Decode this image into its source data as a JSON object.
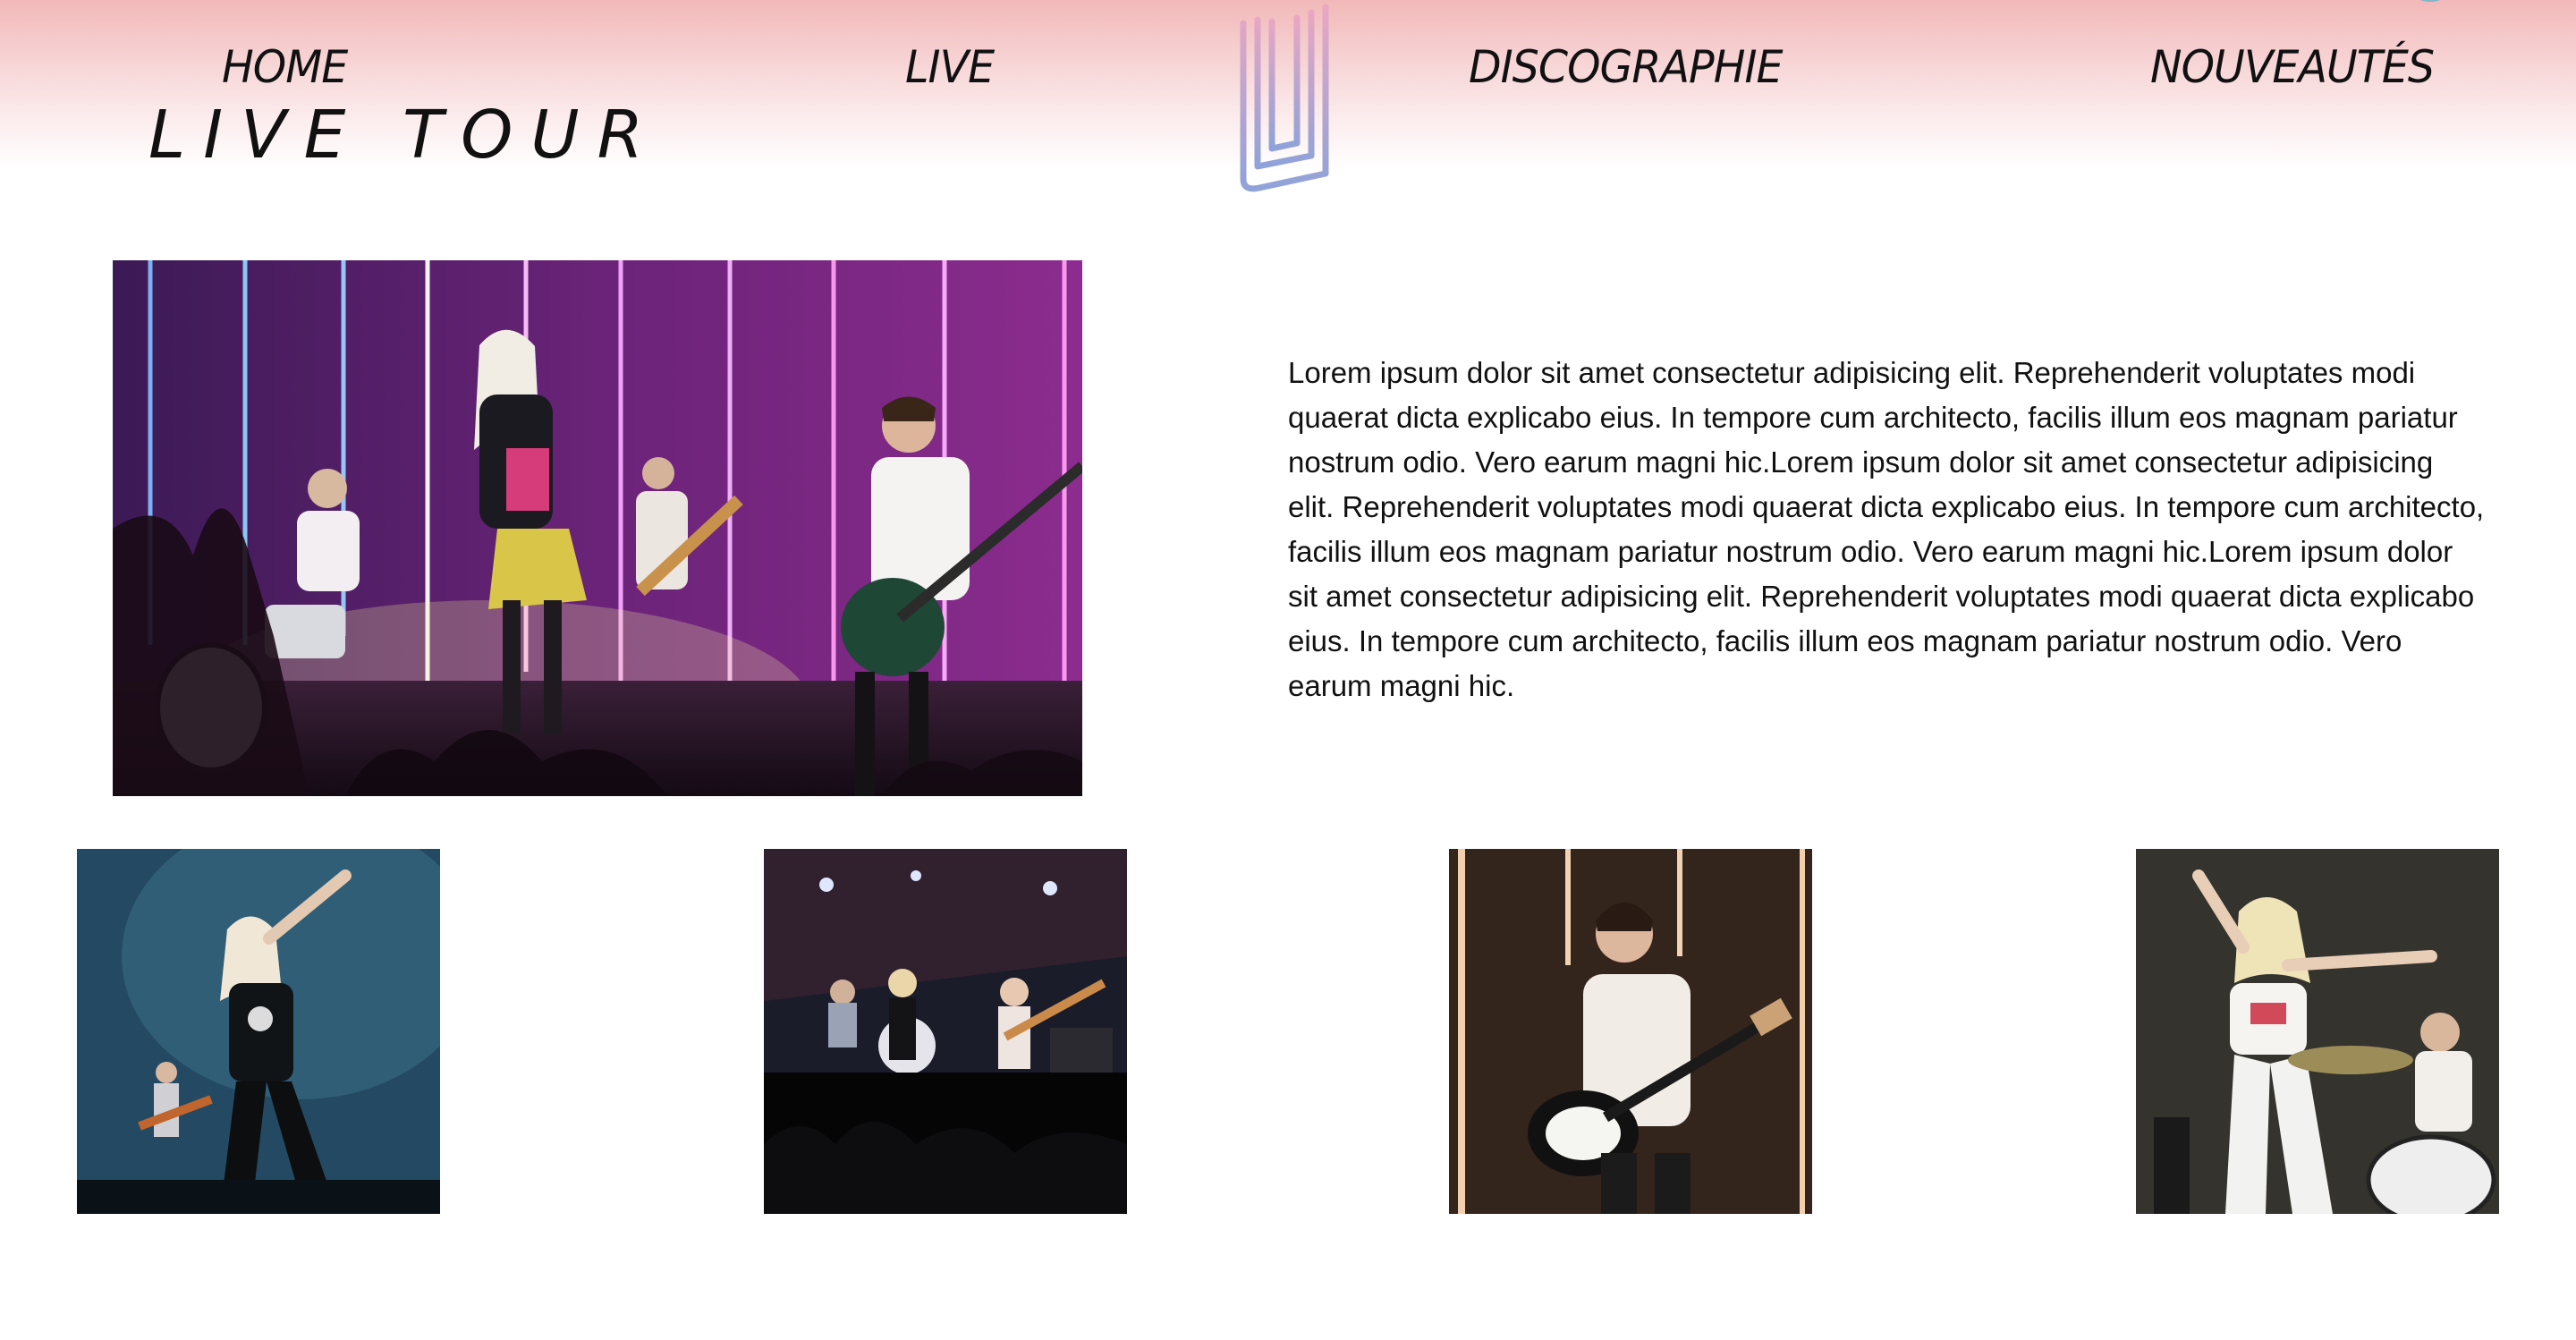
{
  "nav": {
    "items": [
      {
        "label": "HOME"
      },
      {
        "label": "LIVE"
      },
      {
        "label": "DISCOGRAPHIE"
      },
      {
        "label": "NOUVEAUTÉS"
      }
    ]
  },
  "page": {
    "title": "LIVE TOUR"
  },
  "intro": {
    "text": "Lorem ipsum dolor sit amet consectetur adipisicing elit. Reprehenderit voluptates modi quaerat dicta explicabo eius. In tempore cum architecto, facilis illum eos magnam pariatur nostrum odio. Vero earum magni hic.Lorem ipsum dolor sit amet consectetur adipisicing elit. Reprehenderit voluptates modi quaerat dicta explicabo eius. In tempore cum architecto, facilis illum eos magnam pariatur nostrum odio. Vero earum magni hic.Lorem ipsum dolor sit amet consectetur adipisicing elit. Reprehenderit voluptates modi quaerat dicta explicabo eius. In tempore cum architecto, facilis illum eos magnam pariatur nostrum odio. Vero earum magni hic."
  },
  "colors": {
    "header_top": "#f2b8b9",
    "logo_gradient_top": "#e9a7c4",
    "logo_gradient_bottom": "#8fa3d8",
    "text": "#111111"
  },
  "gallery": {
    "photos": [
      {
        "subject": "singer-with-band-on-stage"
      },
      {
        "subject": "band-wide-stage-shot"
      },
      {
        "subject": "guitarist-portrait"
      },
      {
        "subject": "singer-with-drummer"
      }
    ]
  }
}
